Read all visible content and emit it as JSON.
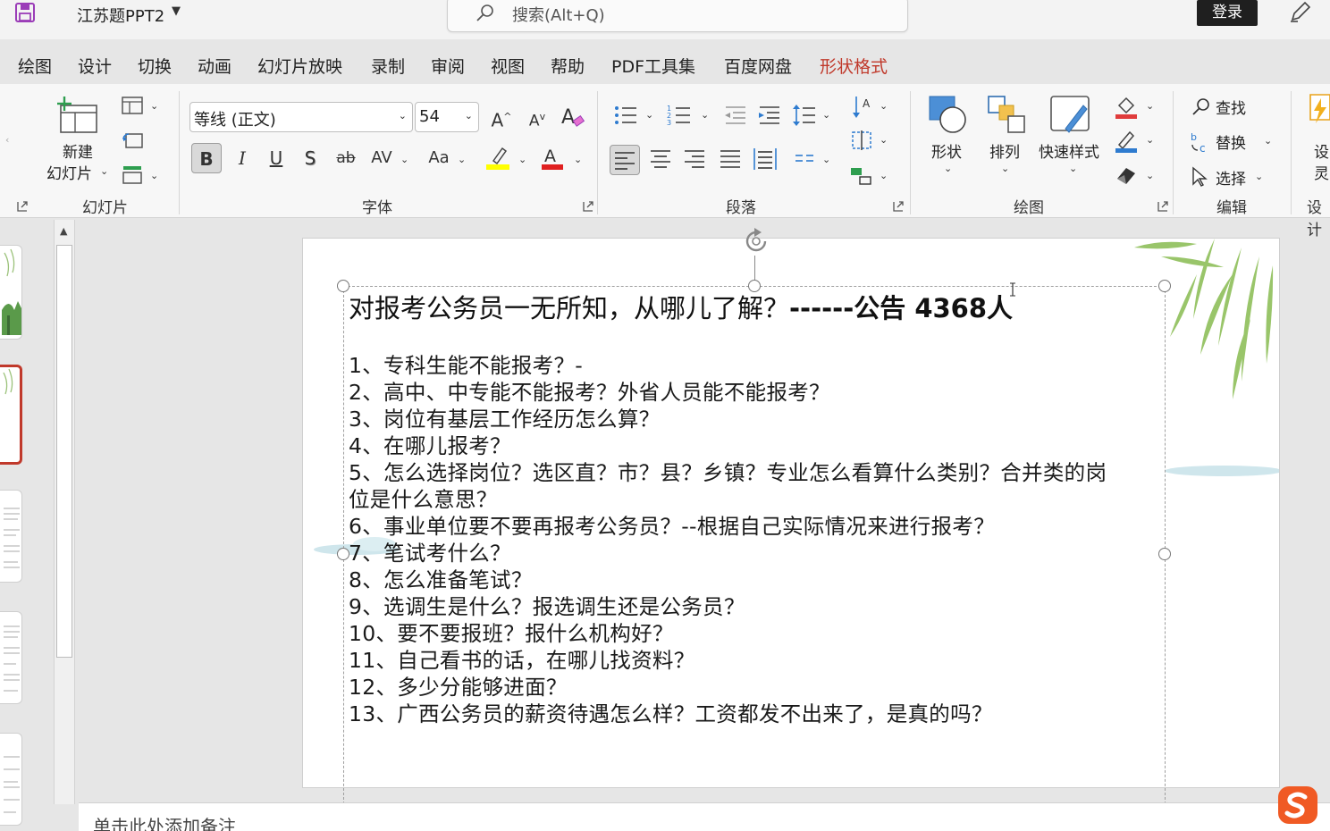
{
  "titlebar": {
    "doc_title": "江苏题PPT2",
    "search_placeholder": "搜索(Alt+Q)",
    "login": "登录"
  },
  "tabs": [
    "绘图",
    "设计",
    "切换",
    "动画",
    "幻灯片放映",
    "录制",
    "审阅",
    "视图",
    "帮助",
    "PDF工具集",
    "百度网盘",
    "形状格式"
  ],
  "ribbon": {
    "slides_group": {
      "label": "幻灯片",
      "new_slide_line1": "新建",
      "new_slide_line2": "幻灯片"
    },
    "font_group": {
      "label": "字体",
      "font_name": "等线 (正文)",
      "font_size": "54",
      "bold": "B",
      "italic": "I",
      "underline": "U",
      "shadow": "S",
      "strike": "ab",
      "spacing": "AV",
      "case": "Aa",
      "grow": "A",
      "shrink": "A"
    },
    "paragraph_group": {
      "label": "段落"
    },
    "drawing_group": {
      "label": "绘图",
      "shape": "形状",
      "arrange": "排列",
      "quick_styles": "快速样式"
    },
    "editing_group": {
      "label": "编辑",
      "find": "查找",
      "replace": "替换",
      "select": "选择"
    },
    "design_group": {
      "label": "设计",
      "partial_1": "设",
      "partial_2": "灵"
    }
  },
  "slide": {
    "title_normal": "对报考公务员一无所知，从哪儿了解？",
    "title_bold": "------公告 4368人",
    "lines": [
      "1、专科生能不能报考？-",
      "2、高中、中专能不能报考？外省人员能不能报考？",
      "3、岗位有基层工作经历怎么算？",
      "4、在哪儿报考？",
      "5、怎么选择岗位？选区直？市？县？乡镇？专业怎么看算什么类别？合并类的岗",
      "位是什么意思？",
      "6、事业单位要不要再报考公务员？--根据自己实际情况来进行报考？",
      "7、笔试考什么？",
      "8、怎么准备笔试？",
      "9、选调生是什么？报选调生还是公务员？",
      "10、要不要报班？报什么机构好？",
      "11、自己看书的话，在哪儿找资料？",
      "12、多少分能够进面？",
      "13、广西公务员的薪资待遇怎么样？工资都发不出来了，是真的吗？"
    ]
  },
  "notes": {
    "placeholder": "单击此处添加备注"
  },
  "colors": {
    "accent_red": "#c0392b",
    "save_purple": "#8e44ad",
    "highlight_yellow": "#ffff00",
    "font_red": "#e02020"
  }
}
